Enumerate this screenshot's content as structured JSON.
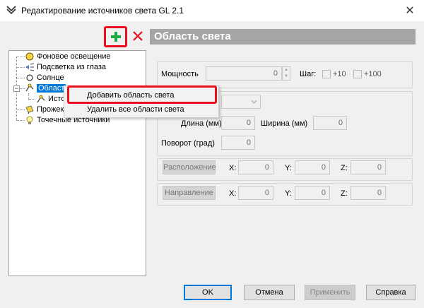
{
  "window": {
    "title": "Редактирование источников света GL 2.1"
  },
  "panel": {
    "header": "Область света",
    "power_label": "Мощность",
    "power_value": "0",
    "step_label": "Шаг:",
    "step_10": "+10",
    "step_100": "+100",
    "length_label": "Длина (мм)",
    "length_value": "0",
    "width_label": "Ширина (мм)",
    "width_value": "0",
    "rotation_label": "Поворот (град)",
    "rotation_value": "0",
    "location_button": "Расположение",
    "direction_button": "Направление",
    "x_label": "X:",
    "y_label": "Y:",
    "z_label": "Z:",
    "loc_x": "0",
    "loc_y": "0",
    "loc_z": "0",
    "dir_x": "0",
    "dir_y": "0",
    "dir_z": "0"
  },
  "tree": {
    "items": [
      {
        "label": "Фоновое освещение"
      },
      {
        "label": "Подсветка из глаза"
      },
      {
        "label": "Солнце"
      },
      {
        "label": "Област"
      },
      {
        "label": "Исто"
      },
      {
        "label": "Прожек"
      },
      {
        "label": "Точечные источники"
      }
    ]
  },
  "context_menu": {
    "items": [
      {
        "label": "Добавить область света"
      },
      {
        "label": "Удалить все области света"
      }
    ]
  },
  "buttons": {
    "ok": "OK",
    "cancel": "Отмена",
    "apply": "Применить",
    "help": "Справка"
  },
  "colors": {
    "accent": "#0078d7",
    "highlight": "#e8101d",
    "add_green": "#1aab3c",
    "delete_red": "#e8101d",
    "header_gray": "#a6a6a6"
  }
}
